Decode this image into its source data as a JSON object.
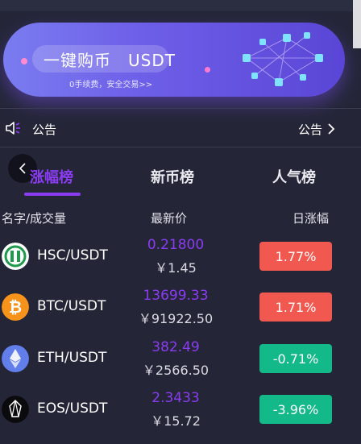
{
  "banner": {
    "title": "一键购币　USDT",
    "subtitle": "0手续费，安全交易>>"
  },
  "notice": {
    "label": "公告",
    "more_label": "公告"
  },
  "tabs": [
    {
      "label": "涨幅榜",
      "active": true
    },
    {
      "label": "新币榜",
      "active": false
    },
    {
      "label": "人气榜",
      "active": false
    }
  ],
  "columns": {
    "name": "名字/成交量",
    "price": "最新价",
    "change": "日涨幅"
  },
  "rows": [
    {
      "pair": "HSC/USDT",
      "price": "0.21800",
      "cny": "￥1.45",
      "change": "1.77%",
      "direction": "up",
      "icon": "hsc-coin-icon"
    },
    {
      "pair": "BTC/USDT",
      "price": "13699.33",
      "cny": "￥91922.50",
      "change": "1.71%",
      "direction": "up",
      "icon": "btc-coin-icon"
    },
    {
      "pair": "ETH/USDT",
      "price": "382.49",
      "cny": "￥2566.50",
      "change": "-0.71%",
      "direction": "down",
      "icon": "eth-coin-icon"
    },
    {
      "pair": "EOS/USDT",
      "price": "2.3433",
      "cny": "￥15.72",
      "change": "-3.96%",
      "direction": "down",
      "icon": "eos-coin-icon"
    }
  ],
  "colors": {
    "accent": "#8b3cf0",
    "up": "#f1584f",
    "down": "#14b98a",
    "background": "#242638"
  }
}
